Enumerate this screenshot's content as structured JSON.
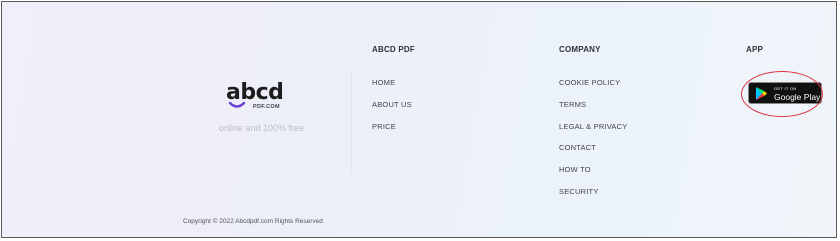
{
  "brand": {
    "logo_word": "abcd",
    "logo_sub": "PDF.COM",
    "tagline": "online and 100% free"
  },
  "columns": {
    "abcd_pdf": {
      "title": "ABCD PDF",
      "links": [
        "HOME",
        "ABOUT US",
        "PRICE"
      ]
    },
    "company": {
      "title": "COMPANY",
      "links": [
        "COOKIE POLICY",
        "TERMS",
        "LEGAL & PRIVACY",
        "CONTACT",
        "HOW TO",
        "SECURITY"
      ]
    },
    "app": {
      "title": "APP",
      "store_badge": {
        "small_text": "GET IT ON",
        "big_text": "Google Play"
      }
    }
  },
  "copyright": "Copyright © 2022 Abcdpdf.com Rights Reserved",
  "colors": {
    "highlight_ring": "#d9333f",
    "logo_smile": "#6b3fd6",
    "badge_bg": "#111111"
  },
  "icons": [
    "google-play-icon",
    "logo-smile-icon"
  ]
}
